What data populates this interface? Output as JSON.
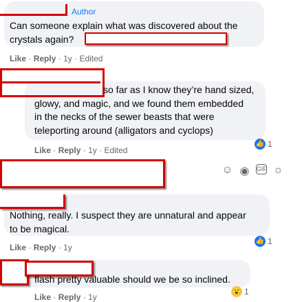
{
  "comments": [
    {
      "author_badge": "Author",
      "text": "Can someone explain what was discovered about the crystals again?",
      "text_suffix": "?",
      "actions": {
        "like": "Like",
        "reply": "Reply",
        "time": "1y",
        "edited": "Edited"
      }
    },
    {
      "text": "so far as I know they're hand sized, glowy, and magic, and we found them embedded in the necks of the sewer beasts that were teleporting around (alligators and cyclops)",
      "line1": "so far as I know they’re hand sized,",
      "line2": "glowy, and magic, and we found them embedded",
      "line3": "in the necks of the sewer beasts that were",
      "line4": "teleporting around (alligators and cyclops)",
      "actions": {
        "like": "Like",
        "reply": "Reply",
        "time": "1y",
        "edited": "Edited"
      },
      "reaction": {
        "icon": "like-icon",
        "count": "1"
      }
    },
    {
      "line1": "Nothing, really. I suspect they are unnatural and appear",
      "line2": "to be magical.",
      "actions": {
        "like": "Like",
        "reply": "Reply",
        "time": "1y"
      },
      "reaction": {
        "icon": "like-icon",
        "count": "1"
      }
    },
    {
      "line1": "flash pretty valuable should we be so inclined.",
      "actions": {
        "like": "Like",
        "reply": "Reply",
        "time": "1y"
      },
      "reaction": {
        "icon": "wow-icon",
        "count": "1"
      }
    }
  ],
  "input_icons": [
    "emoji-icon",
    "camera-icon",
    "gif-icon",
    "sticker-icon"
  ],
  "colors": {
    "redaction": "#d40000",
    "bubble": "#f0f2f5",
    "accent": "#1877f2",
    "meta": "#65676b"
  }
}
